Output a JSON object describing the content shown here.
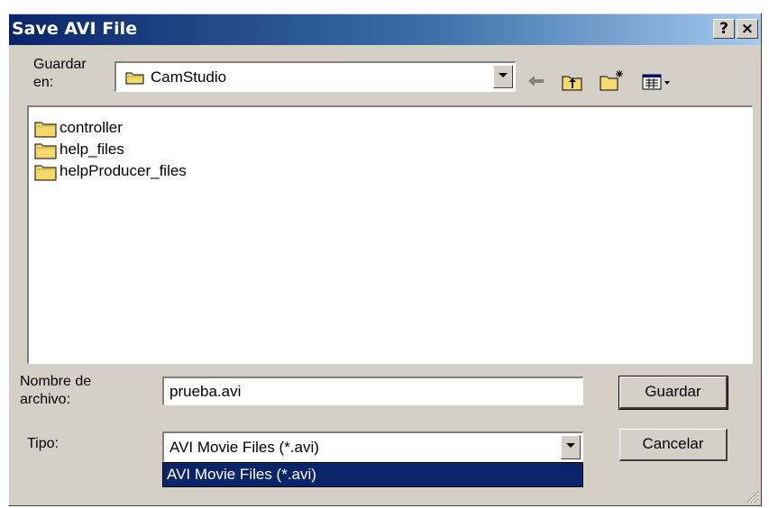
{
  "window": {
    "title": "Save AVI File",
    "help_button": "?",
    "close_button": "×"
  },
  "location": {
    "label_line1": "Guardar",
    "label_line2": "en:",
    "folder": "CamStudio"
  },
  "toolbar": {
    "icons": [
      "back-icon",
      "up-folder-icon",
      "new-folder-icon",
      "view-menu-icon"
    ]
  },
  "files": [
    {
      "name": "controller"
    },
    {
      "name": "help_files"
    },
    {
      "name": "helpProducer_files"
    }
  ],
  "filename": {
    "label_line1": "Nombre de",
    "label_line2": "archivo:",
    "value": "prueba.avi"
  },
  "filetype": {
    "label": "Tipo:",
    "value": "AVI Movie Files (*.avi)",
    "options": [
      "AVI Movie Files (*.avi)"
    ]
  },
  "buttons": {
    "save": "Guardar",
    "cancel": "Cancelar"
  },
  "colors": {
    "title_bar": "#0a246a",
    "face": "#d4d0c8",
    "selection": "#0a246a"
  }
}
